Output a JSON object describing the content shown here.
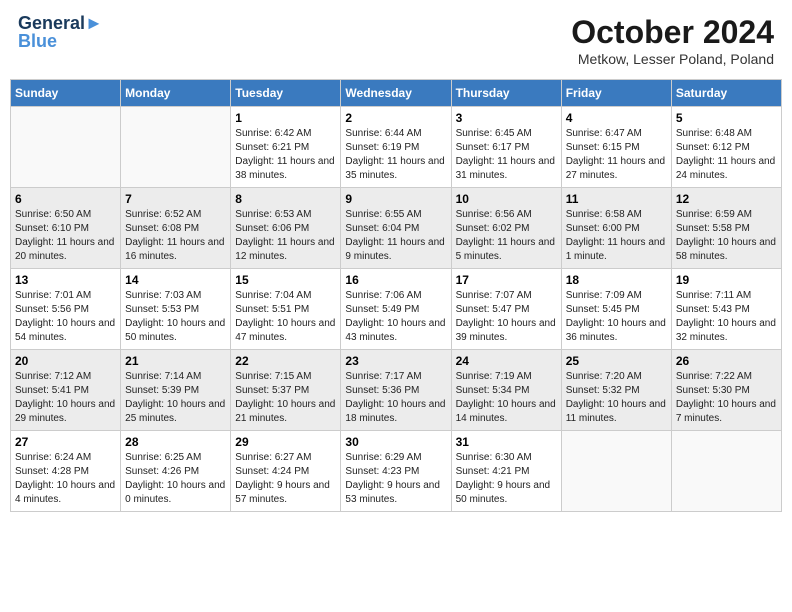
{
  "header": {
    "logo_line1": "General",
    "logo_line2": "Blue",
    "month_title": "October 2024",
    "location": "Metkow, Lesser Poland, Poland"
  },
  "weekdays": [
    "Sunday",
    "Monday",
    "Tuesday",
    "Wednesday",
    "Thursday",
    "Friday",
    "Saturday"
  ],
  "weeks": [
    [
      {
        "day": "",
        "sunrise": "",
        "sunset": "",
        "daylight": ""
      },
      {
        "day": "",
        "sunrise": "",
        "sunset": "",
        "daylight": ""
      },
      {
        "day": "1",
        "sunrise": "Sunrise: 6:42 AM",
        "sunset": "Sunset: 6:21 PM",
        "daylight": "Daylight: 11 hours and 38 minutes."
      },
      {
        "day": "2",
        "sunrise": "Sunrise: 6:44 AM",
        "sunset": "Sunset: 6:19 PM",
        "daylight": "Daylight: 11 hours and 35 minutes."
      },
      {
        "day": "3",
        "sunrise": "Sunrise: 6:45 AM",
        "sunset": "Sunset: 6:17 PM",
        "daylight": "Daylight: 11 hours and 31 minutes."
      },
      {
        "day": "4",
        "sunrise": "Sunrise: 6:47 AM",
        "sunset": "Sunset: 6:15 PM",
        "daylight": "Daylight: 11 hours and 27 minutes."
      },
      {
        "day": "5",
        "sunrise": "Sunrise: 6:48 AM",
        "sunset": "Sunset: 6:12 PM",
        "daylight": "Daylight: 11 hours and 24 minutes."
      }
    ],
    [
      {
        "day": "6",
        "sunrise": "Sunrise: 6:50 AM",
        "sunset": "Sunset: 6:10 PM",
        "daylight": "Daylight: 11 hours and 20 minutes."
      },
      {
        "day": "7",
        "sunrise": "Sunrise: 6:52 AM",
        "sunset": "Sunset: 6:08 PM",
        "daylight": "Daylight: 11 hours and 16 minutes."
      },
      {
        "day": "8",
        "sunrise": "Sunrise: 6:53 AM",
        "sunset": "Sunset: 6:06 PM",
        "daylight": "Daylight: 11 hours and 12 minutes."
      },
      {
        "day": "9",
        "sunrise": "Sunrise: 6:55 AM",
        "sunset": "Sunset: 6:04 PM",
        "daylight": "Daylight: 11 hours and 9 minutes."
      },
      {
        "day": "10",
        "sunrise": "Sunrise: 6:56 AM",
        "sunset": "Sunset: 6:02 PM",
        "daylight": "Daylight: 11 hours and 5 minutes."
      },
      {
        "day": "11",
        "sunrise": "Sunrise: 6:58 AM",
        "sunset": "Sunset: 6:00 PM",
        "daylight": "Daylight: 11 hours and 1 minute."
      },
      {
        "day": "12",
        "sunrise": "Sunrise: 6:59 AM",
        "sunset": "Sunset: 5:58 PM",
        "daylight": "Daylight: 10 hours and 58 minutes."
      }
    ],
    [
      {
        "day": "13",
        "sunrise": "Sunrise: 7:01 AM",
        "sunset": "Sunset: 5:56 PM",
        "daylight": "Daylight: 10 hours and 54 minutes."
      },
      {
        "day": "14",
        "sunrise": "Sunrise: 7:03 AM",
        "sunset": "Sunset: 5:53 PM",
        "daylight": "Daylight: 10 hours and 50 minutes."
      },
      {
        "day": "15",
        "sunrise": "Sunrise: 7:04 AM",
        "sunset": "Sunset: 5:51 PM",
        "daylight": "Daylight: 10 hours and 47 minutes."
      },
      {
        "day": "16",
        "sunrise": "Sunrise: 7:06 AM",
        "sunset": "Sunset: 5:49 PM",
        "daylight": "Daylight: 10 hours and 43 minutes."
      },
      {
        "day": "17",
        "sunrise": "Sunrise: 7:07 AM",
        "sunset": "Sunset: 5:47 PM",
        "daylight": "Daylight: 10 hours and 39 minutes."
      },
      {
        "day": "18",
        "sunrise": "Sunrise: 7:09 AM",
        "sunset": "Sunset: 5:45 PM",
        "daylight": "Daylight: 10 hours and 36 minutes."
      },
      {
        "day": "19",
        "sunrise": "Sunrise: 7:11 AM",
        "sunset": "Sunset: 5:43 PM",
        "daylight": "Daylight: 10 hours and 32 minutes."
      }
    ],
    [
      {
        "day": "20",
        "sunrise": "Sunrise: 7:12 AM",
        "sunset": "Sunset: 5:41 PM",
        "daylight": "Daylight: 10 hours and 29 minutes."
      },
      {
        "day": "21",
        "sunrise": "Sunrise: 7:14 AM",
        "sunset": "Sunset: 5:39 PM",
        "daylight": "Daylight: 10 hours and 25 minutes."
      },
      {
        "day": "22",
        "sunrise": "Sunrise: 7:15 AM",
        "sunset": "Sunset: 5:37 PM",
        "daylight": "Daylight: 10 hours and 21 minutes."
      },
      {
        "day": "23",
        "sunrise": "Sunrise: 7:17 AM",
        "sunset": "Sunset: 5:36 PM",
        "daylight": "Daylight: 10 hours and 18 minutes."
      },
      {
        "day": "24",
        "sunrise": "Sunrise: 7:19 AM",
        "sunset": "Sunset: 5:34 PM",
        "daylight": "Daylight: 10 hours and 14 minutes."
      },
      {
        "day": "25",
        "sunrise": "Sunrise: 7:20 AM",
        "sunset": "Sunset: 5:32 PM",
        "daylight": "Daylight: 10 hours and 11 minutes."
      },
      {
        "day": "26",
        "sunrise": "Sunrise: 7:22 AM",
        "sunset": "Sunset: 5:30 PM",
        "daylight": "Daylight: 10 hours and 7 minutes."
      }
    ],
    [
      {
        "day": "27",
        "sunrise": "Sunrise: 6:24 AM",
        "sunset": "Sunset: 4:28 PM",
        "daylight": "Daylight: 10 hours and 4 minutes."
      },
      {
        "day": "28",
        "sunrise": "Sunrise: 6:25 AM",
        "sunset": "Sunset: 4:26 PM",
        "daylight": "Daylight: 10 hours and 0 minutes."
      },
      {
        "day": "29",
        "sunrise": "Sunrise: 6:27 AM",
        "sunset": "Sunset: 4:24 PM",
        "daylight": "Daylight: 9 hours and 57 minutes."
      },
      {
        "day": "30",
        "sunrise": "Sunrise: 6:29 AM",
        "sunset": "Sunset: 4:23 PM",
        "daylight": "Daylight: 9 hours and 53 minutes."
      },
      {
        "day": "31",
        "sunrise": "Sunrise: 6:30 AM",
        "sunset": "Sunset: 4:21 PM",
        "daylight": "Daylight: 9 hours and 50 minutes."
      },
      {
        "day": "",
        "sunrise": "",
        "sunset": "",
        "daylight": ""
      },
      {
        "day": "",
        "sunrise": "",
        "sunset": "",
        "daylight": ""
      }
    ]
  ]
}
